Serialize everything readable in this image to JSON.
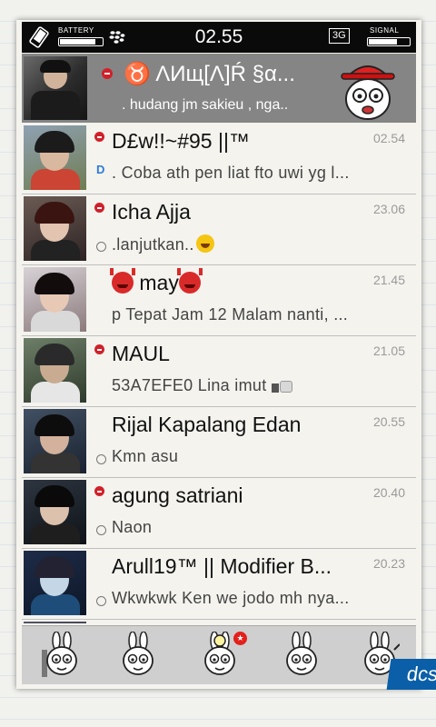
{
  "status_bar": {
    "battery_label": "BATTERY",
    "battery_level": 0.85,
    "time": "02.55",
    "network": "3G",
    "signal_label": "SIGNAL",
    "signal_level": 0.7
  },
  "profile": {
    "zodiac": "♉",
    "name": "ΛИщ[Λ]Ŕ §α...",
    "personal_message": ". hudang jm sakieu , nga.."
  },
  "chats": [
    {
      "name": "D£w!!~#95 ||™",
      "time": "02.54",
      "message": "Coba ath pen liat fto uwi yg l...",
      "busy": true,
      "msg_icon": "delivered-d"
    },
    {
      "name": "Icha Ajja",
      "time": "23.06",
      "message": ".lanjutkan..",
      "busy": true,
      "msg_icon": "read-circle",
      "emoji": "laugh-emoji"
    },
    {
      "name": "may",
      "time": "21.45",
      "message": "p Tepat Jam 12 Malam nanti, ...",
      "busy": false,
      "msg_icon": "none",
      "emoji": "devil-emoji"
    },
    {
      "name": "MAUL",
      "time": "21.05",
      "message": "53A7EFE0 Lina imut",
      "busy": true,
      "msg_icon": "none",
      "emoji": "thumbs-up-emoji"
    },
    {
      "name": "Rijal Kapalang Edan",
      "time": "20.55",
      "message": "Kmn asu",
      "busy": false,
      "msg_icon": "read-circle"
    },
    {
      "name": "agung satriani",
      "time": "20.40",
      "message": "Naon",
      "busy": true,
      "msg_icon": "read-circle"
    },
    {
      "name": "Arull19™ || Modifier B...",
      "time": "20.23",
      "message": "Wkwkwk Ken we jodo mh nya...",
      "busy": false,
      "msg_icon": "read-circle"
    }
  ],
  "bottom_tabs": [
    {
      "icon": "bunny-peek-icon"
    },
    {
      "icon": "bunny-face-icon"
    },
    {
      "icon": "bunny-bulb-icon",
      "badge": "★"
    },
    {
      "icon": "bunny-smile-icon"
    },
    {
      "icon": "bunny-wave-icon"
    }
  ],
  "watermark": "dcs",
  "colors": {
    "status_bar": "#0a0a0a",
    "profile_bg": "#858585",
    "busy_dot": "#d1202a",
    "delivered": "#2d7bd8",
    "badge": "#e3201b"
  }
}
